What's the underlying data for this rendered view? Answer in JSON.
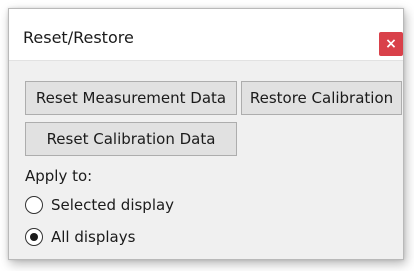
{
  "dialog": {
    "title": "Reset/Restore",
    "close_icon": "close-icon",
    "close_glyph": "×"
  },
  "buttons": {
    "reset_measurement": "Reset Measurement Data",
    "restore_calibration": "Restore Calibration",
    "reset_calibration": "Reset Calibration Data"
  },
  "apply_to": {
    "label": "Apply to:",
    "options": [
      {
        "label": "Selected display",
        "selected": false
      },
      {
        "label": "All displays",
        "selected": true
      }
    ]
  },
  "colors": {
    "close_button_bg": "#d9414a",
    "content_bg": "#f0f0f0",
    "button_bg": "#e1e1e1"
  }
}
